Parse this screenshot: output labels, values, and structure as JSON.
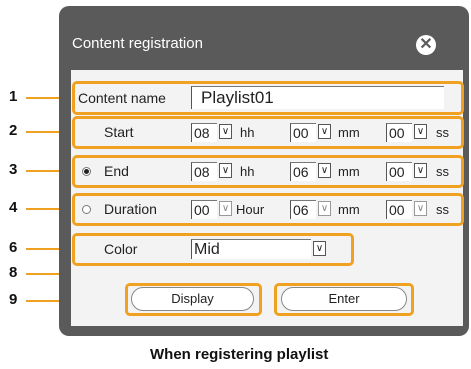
{
  "dialog": {
    "title": "Content registration",
    "close_icon": "close-icon",
    "accent": "#f0a121"
  },
  "content_name": {
    "label": "Content name",
    "value": "Playlist01"
  },
  "start": {
    "label": "Start",
    "hh": "08",
    "hh_unit": "hh",
    "mm": "00",
    "mm_unit": "mm",
    "ss": "00",
    "ss_unit": "ss"
  },
  "end": {
    "label": "End",
    "selected": true,
    "hh": "08",
    "hh_unit": "hh",
    "mm": "06",
    "mm_unit": "mm",
    "ss": "00",
    "ss_unit": "ss"
  },
  "duration": {
    "label": "Duration",
    "selected": false,
    "hour": "00",
    "hour_unit": "Hour",
    "mm": "06",
    "mm_unit": "mm",
    "ss": "00",
    "ss_unit": "ss"
  },
  "color": {
    "label": "Color",
    "value": "Mid"
  },
  "buttons": {
    "display": "Display",
    "enter": "Enter"
  },
  "callouts": [
    "1",
    "2",
    "3",
    "4",
    "6",
    "8",
    "9"
  ],
  "caption": "When registering playlist"
}
